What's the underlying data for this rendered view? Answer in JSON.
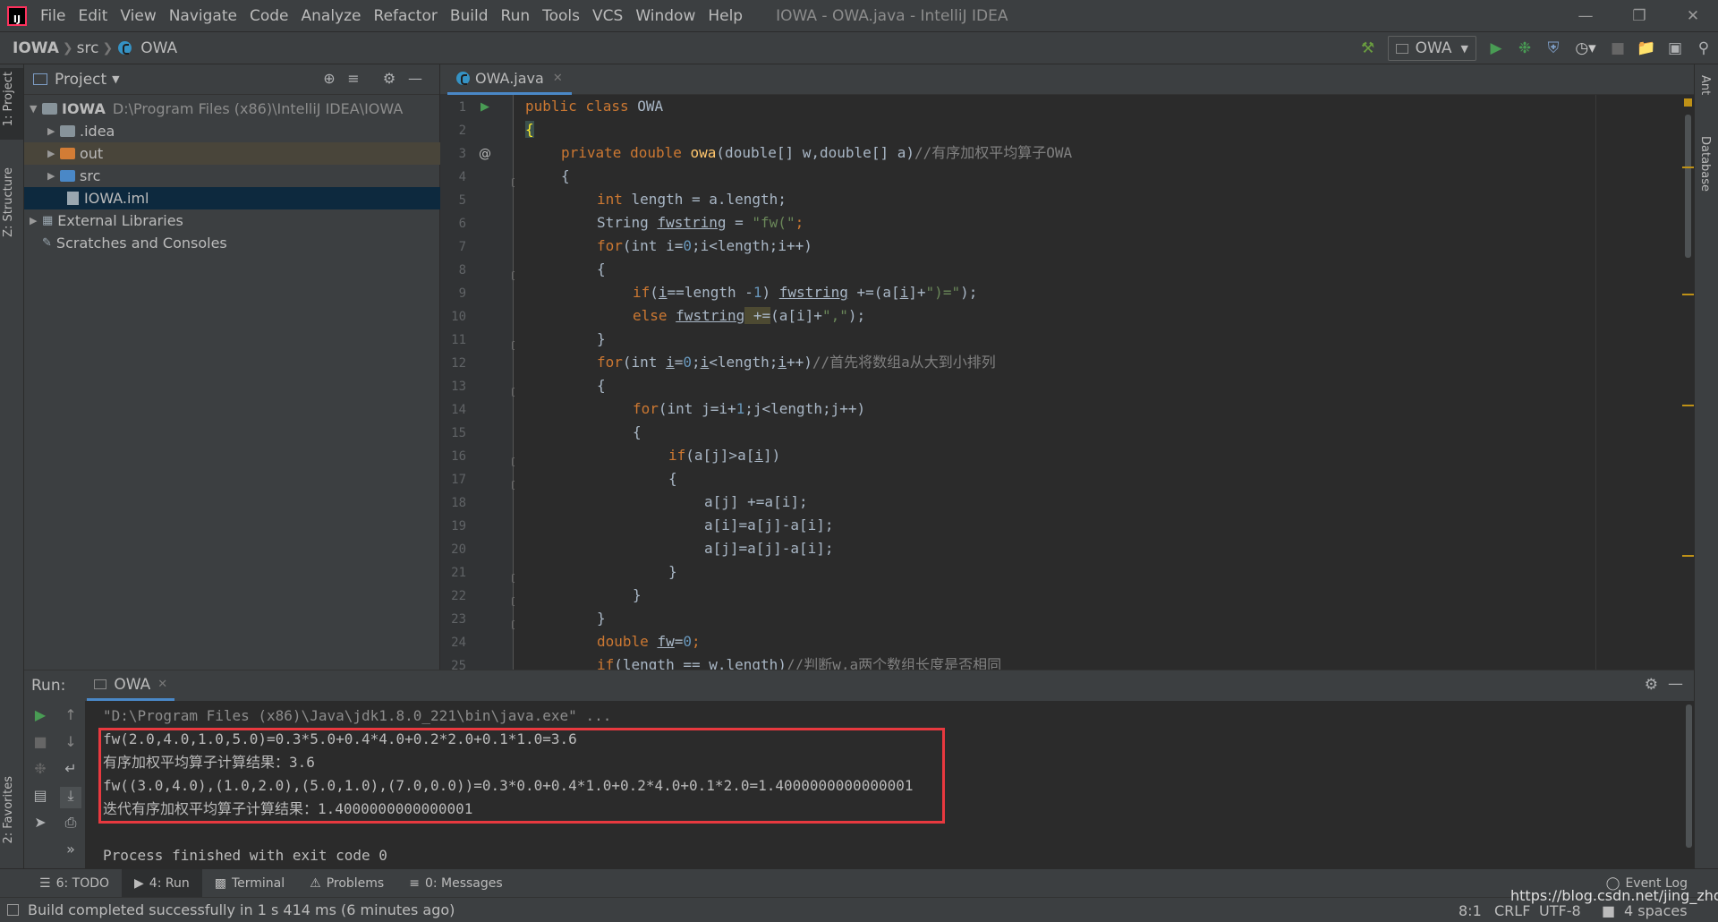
{
  "window": {
    "title": "IOWA - OWA.java - IntelliJ IDEA",
    "logo_text": "IJ",
    "menu": [
      "File",
      "Edit",
      "View",
      "Navigate",
      "Code",
      "Analyze",
      "Refactor",
      "Build",
      "Run",
      "Tools",
      "VCS",
      "Window",
      "Help"
    ]
  },
  "breadcrumb": [
    "IOWA",
    "src",
    "OWA"
  ],
  "toolbar": {
    "run_config": "OWA"
  },
  "left_stripe": {
    "project_tab": "1: Project",
    "structure_tab": "Z: Structure",
    "favorites_tab": "2: Favorites"
  },
  "right_stripe": {
    "ant_tab": "Ant",
    "database_tab": "Database"
  },
  "project_panel": {
    "title": "Project",
    "tree": [
      {
        "label": "IOWA",
        "path": "D:\\Program Files (x86)\\IntelliJ IDEA\\IOWA",
        "expanded": true
      },
      {
        "label": ".idea"
      },
      {
        "label": "out"
      },
      {
        "label": "src"
      },
      {
        "label": "IOWA.iml"
      },
      {
        "label": "External Libraries"
      },
      {
        "label": "Scratches and Consoles"
      }
    ]
  },
  "editor": {
    "tab_label": "OWA.java",
    "line_numbers": [
      "1",
      "2",
      "3",
      "4",
      "5",
      "6",
      "7",
      "8",
      "9",
      "10",
      "11",
      "12",
      "13",
      "14",
      "15",
      "16",
      "17",
      "18",
      "19",
      "20",
      "21",
      "22",
      "23",
      "24",
      "25"
    ]
  },
  "code": {
    "l1_public": "public",
    "l1_class": "class",
    "l1_name": "OWA",
    "l2": "{",
    "l3_private": "private",
    "l3_double": "double",
    "l3_fn": "owa",
    "l3_params": "(double[] w,double[] a)",
    "l3_comment": "//有序加权平均算子OWA",
    "l4": "{",
    "l5_int": "int",
    "l5_rest": " length = a.length;",
    "l6_type": "String ",
    "l6_var": "fwstring",
    "l6_eq": " = ",
    "l6_str": "\"fw(\"",
    "l6_end": ";",
    "l7_for": "for",
    "l7_rest": "(int i=",
    "l7_num": "0",
    "l7_rest2": ";i<length;i++)",
    "l8": "{",
    "l9_if": "if",
    "l9_a": "(",
    "l9_i": "i",
    "l9_b": "==length -",
    "l9_num": "1",
    "l9_c": ") ",
    "l9_var": "fwstring",
    "l9_d": " +=(a[",
    "l9_i2": "i",
    "l9_e": "]+",
    "l9_str": "\")=\"",
    "l9_f": ");",
    "l10_else": "else",
    "l10_sp": " ",
    "l10_var": "fwstring",
    "l10_op": " +=",
    "l10_a": "(a[i]+",
    "l10_str": "\",\"",
    "l10_b": ");",
    "l11": "}",
    "l12_for": "for",
    "l12_a": "(int ",
    "l12_i": "i",
    "l12_b": "=",
    "l12_num": "0",
    "l12_c": ";",
    "l12_i2": "i",
    "l12_d": "<length;",
    "l12_i3": "i",
    "l12_e": "++)",
    "l12_comment": "//首先将数组a从大到小排列",
    "l13": "{",
    "l14_for": "for",
    "l14_a": "(int j=i+",
    "l14_num": "1",
    "l14_b": ";j<length;j++)",
    "l15": "{",
    "l16_if": "if",
    "l16_a": "(a[j]>a[",
    "l16_i": "i",
    "l16_b": "])",
    "l17": "{",
    "l18": "a[j] +=a[i];",
    "l19": "a[i]=a[j]-a[i];",
    "l20": "a[j]=a[j]-a[i];",
    "l21": "}",
    "l22": "}",
    "l23": "}",
    "l24_double": "double",
    "l24_sp": " ",
    "l24_var": "fw",
    "l24_eq": "=",
    "l24_num": "0",
    "l24_end": ";",
    "l25_if": "if",
    "l25_rest": "(length == w.length)",
    "l25_comment": "//判断w,a两个数组长度是否相同"
  },
  "run_panel": {
    "label": "Run:",
    "tab": "OWA",
    "output": [
      "\"D:\\Program Files (x86)\\Java\\jdk1.8.0_221\\bin\\java.exe\" ...",
      "fw(2.0,4.0,1.0,5.0)=0.3*5.0+0.4*4.0+0.2*2.0+0.1*1.0=3.6",
      "有序加权平均算子计算结果：3.6",
      "fw((3.0,4.0),(1.0,2.0),(5.0,1.0),(7.0,0.0))=0.3*0.0+0.4*1.0+0.2*4.0+0.1*2.0=1.4000000000000001",
      "迭代有序加权平均算子计算结果：1.4000000000000001",
      "",
      "Process finished with exit code 0"
    ]
  },
  "bottom_tabs": [
    "6: TODO",
    "4: Run",
    "Terminal",
    "Problems",
    "0: Messages"
  ],
  "event_log": "Event Log",
  "status": {
    "message": "Build completed successfully in 1 s 414 ms (6 minutes ago)",
    "position": "8:1",
    "line_sep": "CRLF",
    "encoding": "UTF-8",
    "indent": "4 spaces",
    "watermark": "https://blog.csdn.net/jing_zhong"
  },
  "colors": {
    "accent": "#4a88c7",
    "highlight_box": "#e8393f",
    "keyword": "#cc7832",
    "string": "#6a8759",
    "number": "#6897bb",
    "comment": "#808080"
  }
}
